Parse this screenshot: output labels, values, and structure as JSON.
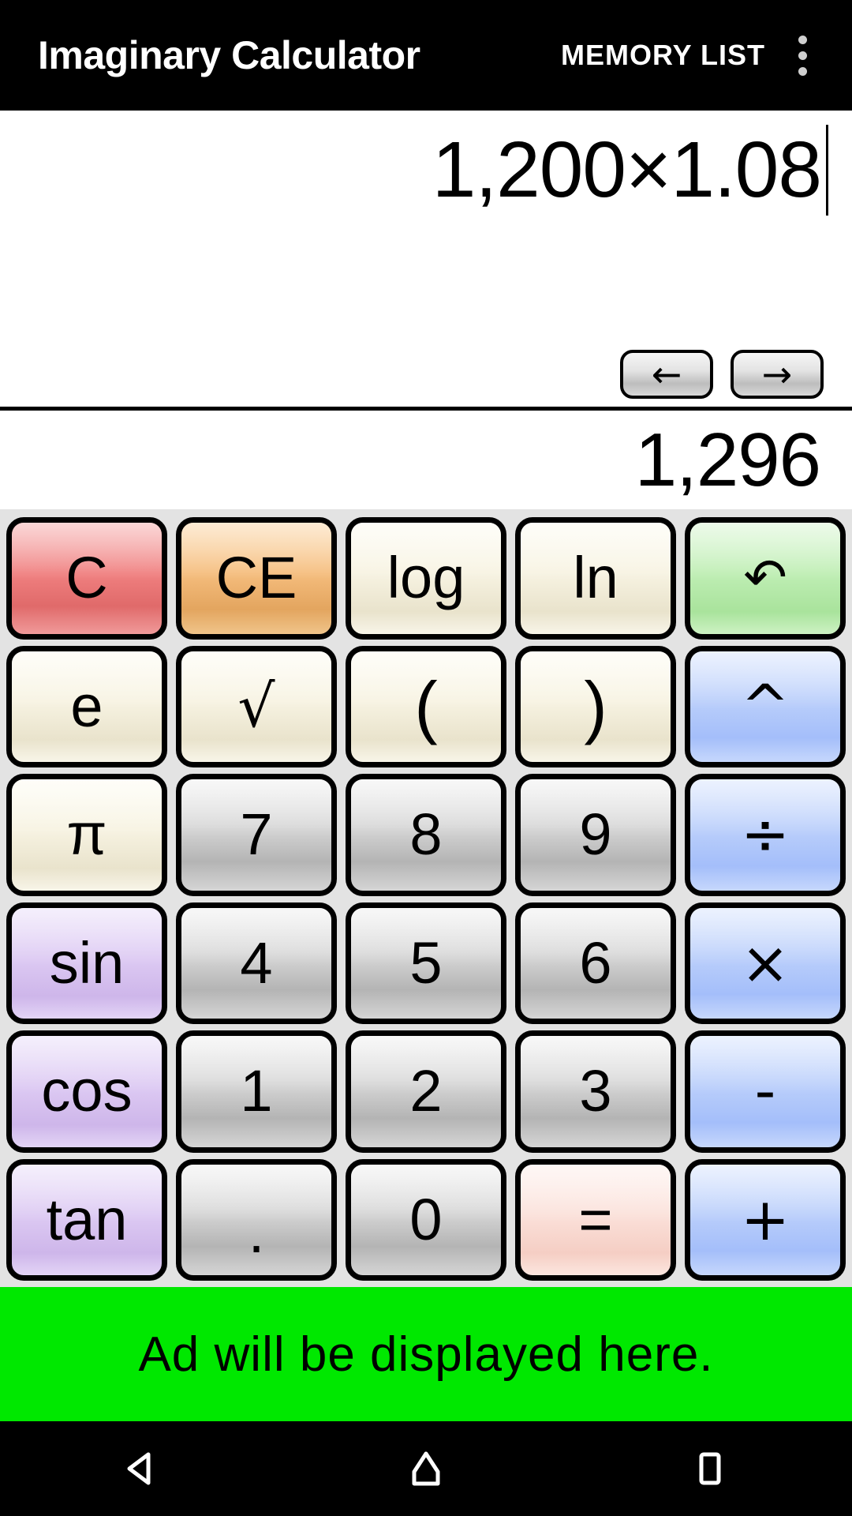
{
  "appbar": {
    "title": "Imaginary Calculator",
    "memory_list_label": "MEMORY LIST",
    "overflow_icon": "more-vert-icon"
  },
  "display": {
    "expression": "1,200×1.08",
    "result": "1,296",
    "cursor_left_label": "←",
    "cursor_right_label": "→"
  },
  "keypad": {
    "rows": [
      [
        {
          "label": "C",
          "name": "clear-button",
          "style": "k-clear"
        },
        {
          "label": "CE",
          "name": "clear-entry-button",
          "style": "k-ce"
        },
        {
          "label": "log",
          "name": "log-button",
          "style": "k-func"
        },
        {
          "label": "ln",
          "name": "ln-button",
          "style": "k-func"
        },
        {
          "label": "↶",
          "name": "undo-button",
          "style": "k-undo"
        }
      ],
      [
        {
          "label": "e",
          "name": "euler-button",
          "style": "k-func"
        },
        {
          "label": "√",
          "name": "square-root-button",
          "style": "k-func k-sqrt"
        },
        {
          "label": "(",
          "name": "open-paren-button",
          "style": "k-func k-paren"
        },
        {
          "label": ")",
          "name": "close-paren-button",
          "style": "k-func k-paren"
        },
        {
          "label": "^",
          "name": "power-button",
          "style": "k-op"
        }
      ],
      [
        {
          "label": "π",
          "name": "pi-button",
          "style": "k-func"
        },
        {
          "label": "7",
          "name": "digit-7-button",
          "style": "k-num"
        },
        {
          "label": "8",
          "name": "digit-8-button",
          "style": "k-num"
        },
        {
          "label": "9",
          "name": "digit-9-button",
          "style": "k-num"
        },
        {
          "label": "÷",
          "name": "divide-button",
          "style": "k-op"
        }
      ],
      [
        {
          "label": "sin",
          "name": "sin-button",
          "style": "k-trig"
        },
        {
          "label": "4",
          "name": "digit-4-button",
          "style": "k-num"
        },
        {
          "label": "5",
          "name": "digit-5-button",
          "style": "k-num"
        },
        {
          "label": "6",
          "name": "digit-6-button",
          "style": "k-num"
        },
        {
          "label": "×",
          "name": "multiply-button",
          "style": "k-op"
        }
      ],
      [
        {
          "label": "cos",
          "name": "cos-button",
          "style": "k-trig"
        },
        {
          "label": "1",
          "name": "digit-1-button",
          "style": "k-num"
        },
        {
          "label": "2",
          "name": "digit-2-button",
          "style": "k-num"
        },
        {
          "label": "3",
          "name": "digit-3-button",
          "style": "k-num"
        },
        {
          "label": "-",
          "name": "subtract-button",
          "style": "k-op"
        }
      ],
      [
        {
          "label": "tan",
          "name": "tan-button",
          "style": "k-trig"
        },
        {
          "label": ".",
          "name": "decimal-point-button",
          "style": "k-num k-dot"
        },
        {
          "label": "0",
          "name": "digit-0-button",
          "style": "k-num"
        },
        {
          "label": "=",
          "name": "equals-button",
          "style": "k-eq"
        },
        {
          "label": "+",
          "name": "add-button",
          "style": "k-op"
        }
      ]
    ]
  },
  "ad": {
    "text": "Ad will be displayed here.",
    "background_color": "#00e800"
  },
  "system_nav": {
    "back_icon": "back-triangle-icon",
    "home_icon": "home-icon",
    "recents_icon": "recents-square-icon"
  }
}
